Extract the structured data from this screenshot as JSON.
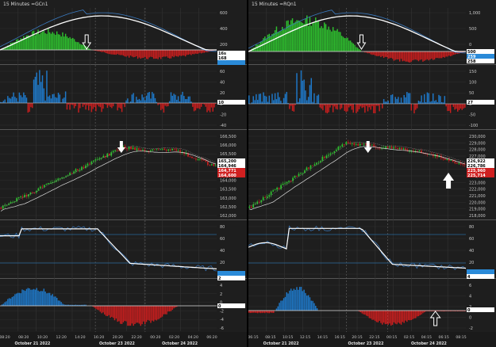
{
  "left": {
    "title": "15 Minutes =GCn1",
    "sub1": {
      "ticks": [
        "600",
        "400",
        "200",
        "0"
      ],
      "badges": [
        {
          "text": "16s",
          "bg": "#ffffff",
          "fg": "#000000"
        },
        {
          "text": "168",
          "bg": "#ffffff",
          "fg": "#000000"
        },
        {
          "text": "",
          "bg": "#2a8ad8",
          "fg": "#ffffff"
        }
      ]
    },
    "sub2": {
      "ticks": [
        "60",
        "40",
        "20",
        "0",
        "-20",
        "-40"
      ],
      "badges": [
        {
          "text": "10",
          "bg": "#ffffff",
          "fg": "#000000"
        }
      ]
    },
    "sub3": {
      "ticks": [
        "166,500",
        "166,000",
        "165,500",
        "165,000",
        "164,500",
        "164,000",
        "163,500",
        "163,000",
        "162,500",
        "162,000"
      ],
      "badges": [
        {
          "text": "165,200",
          "bg": "#ffffff",
          "fg": "#000000"
        },
        {
          "text": "164,946",
          "bg": "#ffffff",
          "fg": "#000000"
        },
        {
          "text": "164,771",
          "bg": "#d02020",
          "fg": "#ffffff"
        },
        {
          "text": "164,600",
          "bg": "#d02020",
          "fg": "#ffffff"
        }
      ]
    },
    "sub4": {
      "ticks": [
        "80",
        "60",
        "40",
        "20",
        "0"
      ],
      "badges": [
        {
          "text": "",
          "bg": "#2a8ad8",
          "fg": "#ffffff"
        },
        {
          "text": "2",
          "bg": "#ffffff",
          "fg": "#000000"
        }
      ]
    },
    "sub5": {
      "ticks": [
        "4",
        "2",
        "0",
        "-2",
        "-4",
        "-6"
      ],
      "badges": [
        {
          "text": "0",
          "bg": "#ffffff",
          "fg": "#000000"
        }
      ]
    },
    "time_labels": [
      "08:20",
      "08:20",
      "10:20",
      "12:20",
      "14:20",
      "16:20",
      "20:20",
      "22:20",
      "00:20",
      "02:20",
      "04:20",
      "06:20"
    ],
    "date_labels": [
      "October 21 2022",
      "October 23 2022",
      "October 24 2022"
    ]
  },
  "right": {
    "title": "15 Minutes =RQn1",
    "sub1": {
      "ticks": [
        "1,000",
        "500",
        "0",
        "-500"
      ],
      "badges": [
        {
          "text": "500",
          "bg": "#ffffff",
          "fg": "#000000"
        },
        {
          "text": "259",
          "bg": "#2a8ad8",
          "fg": "#ffffff"
        },
        {
          "text": "258",
          "bg": "#ffffff",
          "fg": "#000000"
        }
      ]
    },
    "sub2": {
      "ticks": [
        "150",
        "100",
        "50",
        "0",
        "-50",
        "-100"
      ],
      "badges": [
        {
          "text": "27",
          "bg": "#ffffff",
          "fg": "#000000"
        }
      ]
    },
    "sub3": {
      "ticks": [
        "230,000",
        "229,000",
        "228,000",
        "227,000",
        "226,000",
        "225,000",
        "224,000",
        "223,000",
        "222,000",
        "221,000",
        "220,000",
        "219,000",
        "218,000"
      ],
      "badges": [
        {
          "text": "226,922",
          "bg": "#ffffff",
          "fg": "#000000"
        },
        {
          "text": "226,786",
          "bg": "#ffffff",
          "fg": "#000000"
        },
        {
          "text": "225,960",
          "bg": "#d02020",
          "fg": "#ffffff"
        },
        {
          "text": "225,714",
          "bg": "#d02020",
          "fg": "#ffffff"
        }
      ]
    },
    "sub4": {
      "ticks": [
        "80",
        "60",
        "40",
        "20",
        "0"
      ],
      "badges": [
        {
          "text": "",
          "bg": "#2a8ad8",
          "fg": "#ffffff"
        },
        {
          "text": "4",
          "bg": "#ffffff",
          "fg": "#000000"
        }
      ]
    },
    "sub5": {
      "ticks": [
        "6",
        "4",
        "2",
        "0",
        "-2"
      ],
      "badges": [
        {
          "text": "0",
          "bg": "#ffffff",
          "fg": "#000000"
        }
      ]
    },
    "time_labels": [
      "06:15",
      "08:15",
      "10:15",
      "12:15",
      "14:15",
      "16:15",
      "20:15",
      "22:15",
      "00:15",
      "02:15",
      "04:15",
      "06:15",
      "08:15"
    ],
    "date_labels": [
      "October 21 2022",
      "October 23 2022",
      "October 24 2022"
    ]
  },
  "colors": {
    "up": "#2ec02e",
    "down": "#c81e1e",
    "volume": "#1e78c8",
    "panel_bg": "#1e1e1e",
    "grid": "#333333",
    "text": "#c8c8c8",
    "highlight": "#2a8ad8"
  }
}
